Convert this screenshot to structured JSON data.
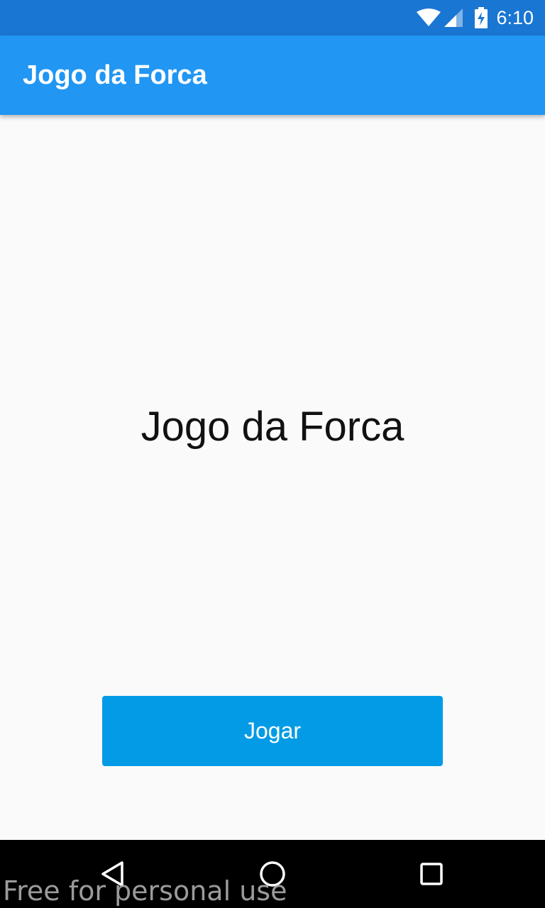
{
  "status_bar": {
    "time": "6:10",
    "icons": [
      "wifi-icon",
      "cell-signal-icon",
      "battery-charging-icon"
    ],
    "color": "#1976d2"
  },
  "app_bar": {
    "title": "Jogo da Forca",
    "color": "#2196f3"
  },
  "main": {
    "headline": "Jogo da Forca",
    "play_button_label": "Jogar",
    "button_color": "#039be5"
  },
  "nav_bar": {
    "icons": [
      "back-icon",
      "home-icon",
      "recents-icon"
    ]
  },
  "watermark": "Free for personal use"
}
